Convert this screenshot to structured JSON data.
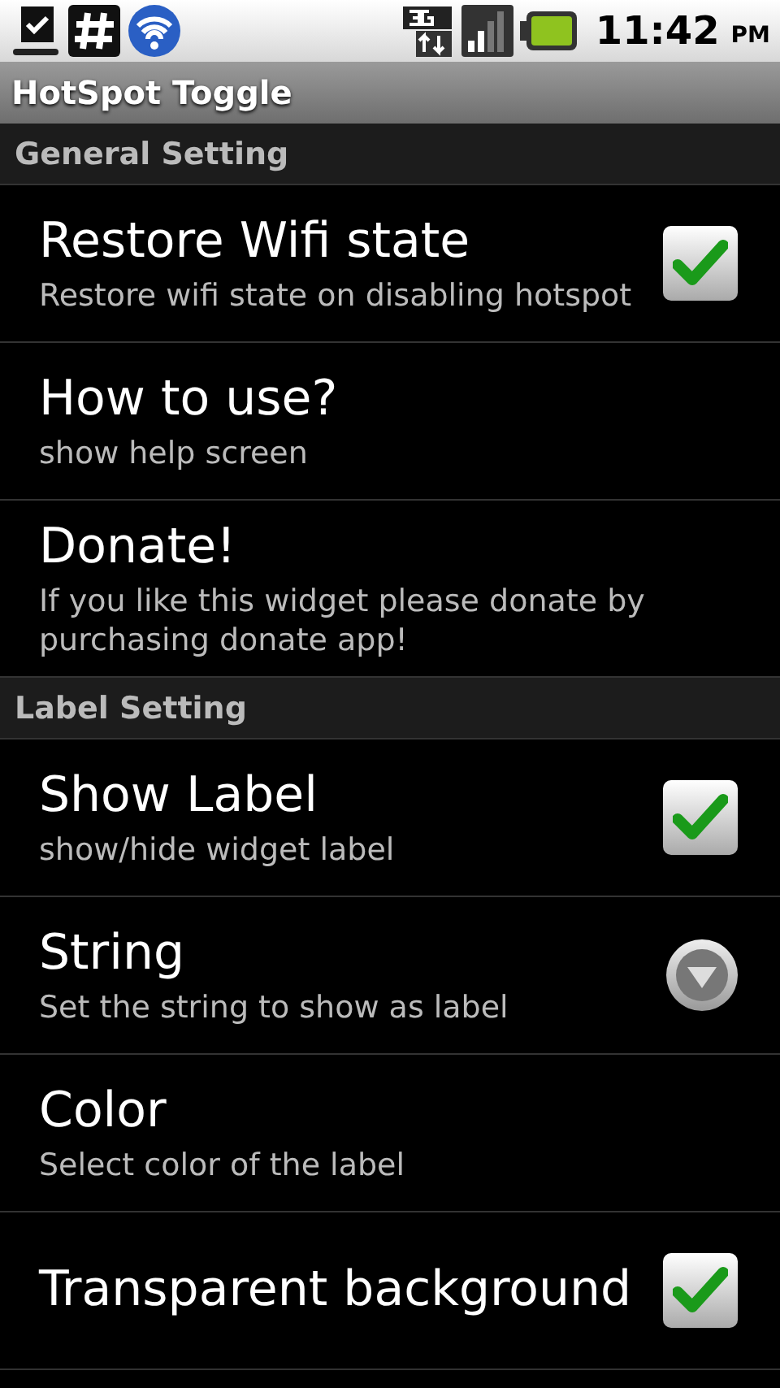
{
  "status_bar": {
    "time": "11:42",
    "period": "PM"
  },
  "window": {
    "title": "HotSpot Toggle"
  },
  "sections": [
    {
      "title": "General Setting",
      "items": [
        {
          "kind": "checkbox",
          "title": "Restore Wifi state",
          "summary": "Restore wifi state on disabling hotspot",
          "checked": true
        },
        {
          "kind": "plain",
          "title": "How to use?",
          "summary": "show help screen"
        },
        {
          "kind": "plain",
          "title": "Donate!",
          "summary": "If you like this widget please donate by purchasing donate app!"
        }
      ]
    },
    {
      "title": "Label Setting",
      "items": [
        {
          "kind": "checkbox",
          "title": "Show Label",
          "summary": "show/hide widget label",
          "checked": true
        },
        {
          "kind": "dropdown",
          "title": "String",
          "summary": "Set the string to show as label"
        },
        {
          "kind": "plain",
          "title": "Color",
          "summary": "Select color of the label"
        },
        {
          "kind": "checkbox",
          "title": "Transparent background",
          "checked": true
        }
      ]
    }
  ]
}
